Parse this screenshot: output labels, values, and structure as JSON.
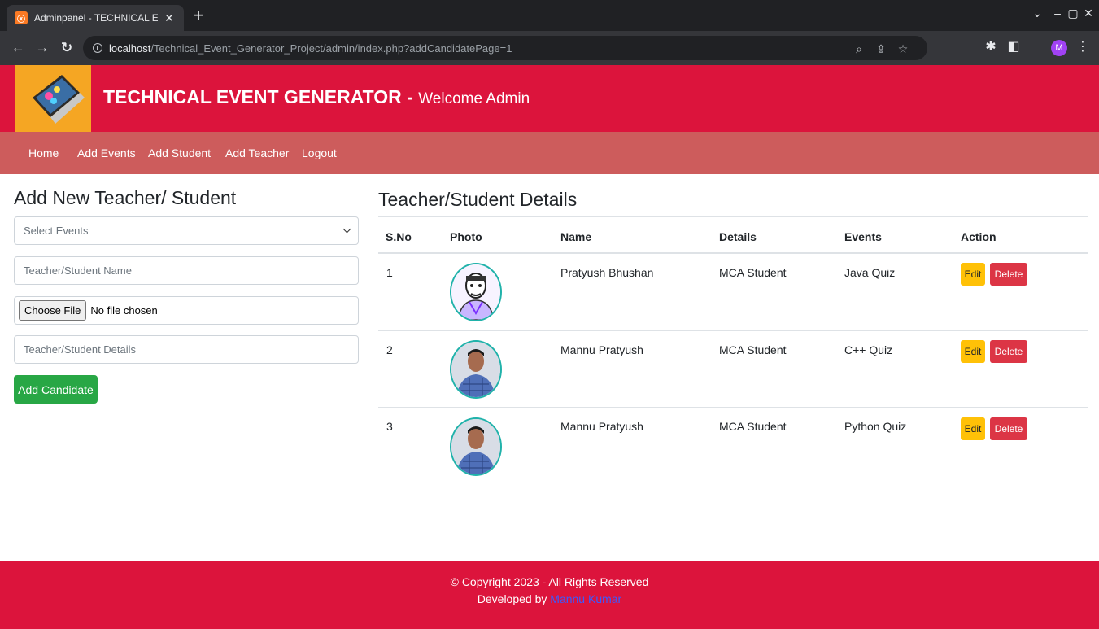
{
  "browser": {
    "tab_title": "Adminpanel - TECHNICAL EVEN",
    "tab_favicon": "ⓧ",
    "url_host": "localhost",
    "url_path": "/Technical_Event_Generator_Project/admin/index.php?addCandidatePage=1",
    "profile_initial": "M"
  },
  "header": {
    "title": "TECHNICAL EVENT GENERATOR",
    "separator": " - ",
    "subtitle": "Welcome Admin"
  },
  "nav": {
    "items": [
      "Home",
      "Add Events",
      "Add Student",
      "Add Teacher",
      "Logout"
    ]
  },
  "form": {
    "heading": "Add New Teacher/ Student",
    "select_placeholder": "Select Events",
    "name_placeholder": "Teacher/Student Name",
    "file_button": "Choose File",
    "file_status": "No file chosen",
    "details_placeholder": "Teacher/Student Details",
    "submit_label": "Add Candidate"
  },
  "table": {
    "heading": "Teacher/Student Details",
    "columns": [
      "S.No",
      "Photo",
      "Name",
      "Details",
      "Events",
      "Action"
    ],
    "rows": [
      {
        "sno": "1",
        "name": "Pratyush Bhushan",
        "details": "MCA Student",
        "event": "Java Quiz",
        "photo_icon": "sketch-portrait"
      },
      {
        "sno": "2",
        "name": "Mannu Pratyush",
        "details": "MCA Student",
        "event": "C++ Quiz",
        "photo_icon": "photo-portrait"
      },
      {
        "sno": "3",
        "name": "Mannu Pratyush",
        "details": "MCA Student",
        "event": "Python Quiz",
        "photo_icon": "photo-portrait"
      }
    ],
    "edit_label": "Edit",
    "delete_label": "Delete"
  },
  "footer": {
    "copyright": "© Copyright 2023 - All Rights Reserved",
    "developed_by": "Developed by ",
    "developer": "Mannu Kumar"
  },
  "colors": {
    "header": "#dc143c",
    "navbar": "#cd5c5c",
    "success": "#28a745",
    "warning": "#ffc107",
    "danger": "#dc3545"
  }
}
